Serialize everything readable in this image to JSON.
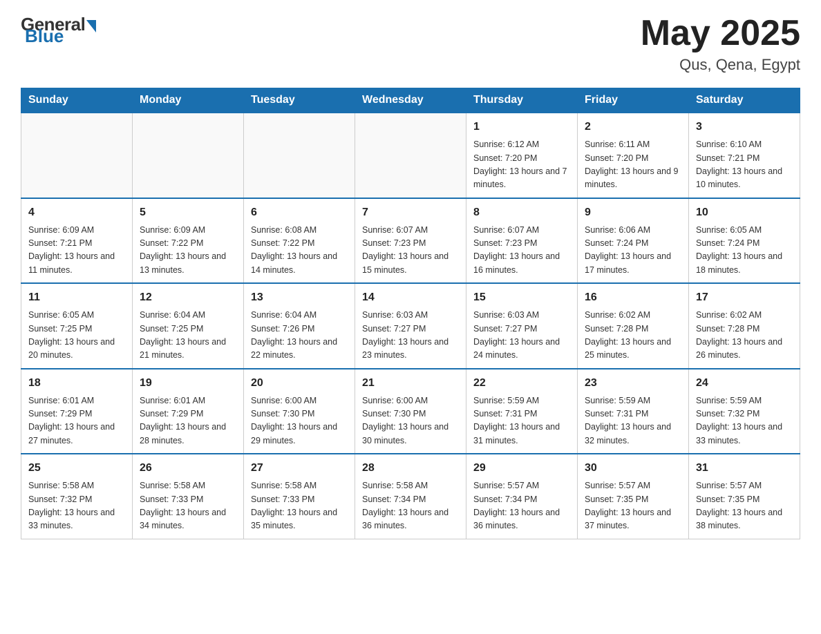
{
  "header": {
    "logo_general": "General",
    "logo_blue": "Blue",
    "month_title": "May 2025",
    "location": "Qus, Qena, Egypt"
  },
  "weekdays": [
    "Sunday",
    "Monday",
    "Tuesday",
    "Wednesday",
    "Thursday",
    "Friday",
    "Saturday"
  ],
  "weeks": [
    [
      {
        "day": "",
        "info": ""
      },
      {
        "day": "",
        "info": ""
      },
      {
        "day": "",
        "info": ""
      },
      {
        "day": "",
        "info": ""
      },
      {
        "day": "1",
        "info": "Sunrise: 6:12 AM\nSunset: 7:20 PM\nDaylight: 13 hours and 7 minutes."
      },
      {
        "day": "2",
        "info": "Sunrise: 6:11 AM\nSunset: 7:20 PM\nDaylight: 13 hours and 9 minutes."
      },
      {
        "day": "3",
        "info": "Sunrise: 6:10 AM\nSunset: 7:21 PM\nDaylight: 13 hours and 10 minutes."
      }
    ],
    [
      {
        "day": "4",
        "info": "Sunrise: 6:09 AM\nSunset: 7:21 PM\nDaylight: 13 hours and 11 minutes."
      },
      {
        "day": "5",
        "info": "Sunrise: 6:09 AM\nSunset: 7:22 PM\nDaylight: 13 hours and 13 minutes."
      },
      {
        "day": "6",
        "info": "Sunrise: 6:08 AM\nSunset: 7:22 PM\nDaylight: 13 hours and 14 minutes."
      },
      {
        "day": "7",
        "info": "Sunrise: 6:07 AM\nSunset: 7:23 PM\nDaylight: 13 hours and 15 minutes."
      },
      {
        "day": "8",
        "info": "Sunrise: 6:07 AM\nSunset: 7:23 PM\nDaylight: 13 hours and 16 minutes."
      },
      {
        "day": "9",
        "info": "Sunrise: 6:06 AM\nSunset: 7:24 PM\nDaylight: 13 hours and 17 minutes."
      },
      {
        "day": "10",
        "info": "Sunrise: 6:05 AM\nSunset: 7:24 PM\nDaylight: 13 hours and 18 minutes."
      }
    ],
    [
      {
        "day": "11",
        "info": "Sunrise: 6:05 AM\nSunset: 7:25 PM\nDaylight: 13 hours and 20 minutes."
      },
      {
        "day": "12",
        "info": "Sunrise: 6:04 AM\nSunset: 7:25 PM\nDaylight: 13 hours and 21 minutes."
      },
      {
        "day": "13",
        "info": "Sunrise: 6:04 AM\nSunset: 7:26 PM\nDaylight: 13 hours and 22 minutes."
      },
      {
        "day": "14",
        "info": "Sunrise: 6:03 AM\nSunset: 7:27 PM\nDaylight: 13 hours and 23 minutes."
      },
      {
        "day": "15",
        "info": "Sunrise: 6:03 AM\nSunset: 7:27 PM\nDaylight: 13 hours and 24 minutes."
      },
      {
        "day": "16",
        "info": "Sunrise: 6:02 AM\nSunset: 7:28 PM\nDaylight: 13 hours and 25 minutes."
      },
      {
        "day": "17",
        "info": "Sunrise: 6:02 AM\nSunset: 7:28 PM\nDaylight: 13 hours and 26 minutes."
      }
    ],
    [
      {
        "day": "18",
        "info": "Sunrise: 6:01 AM\nSunset: 7:29 PM\nDaylight: 13 hours and 27 minutes."
      },
      {
        "day": "19",
        "info": "Sunrise: 6:01 AM\nSunset: 7:29 PM\nDaylight: 13 hours and 28 minutes."
      },
      {
        "day": "20",
        "info": "Sunrise: 6:00 AM\nSunset: 7:30 PM\nDaylight: 13 hours and 29 minutes."
      },
      {
        "day": "21",
        "info": "Sunrise: 6:00 AM\nSunset: 7:30 PM\nDaylight: 13 hours and 30 minutes."
      },
      {
        "day": "22",
        "info": "Sunrise: 5:59 AM\nSunset: 7:31 PM\nDaylight: 13 hours and 31 minutes."
      },
      {
        "day": "23",
        "info": "Sunrise: 5:59 AM\nSunset: 7:31 PM\nDaylight: 13 hours and 32 minutes."
      },
      {
        "day": "24",
        "info": "Sunrise: 5:59 AM\nSunset: 7:32 PM\nDaylight: 13 hours and 33 minutes."
      }
    ],
    [
      {
        "day": "25",
        "info": "Sunrise: 5:58 AM\nSunset: 7:32 PM\nDaylight: 13 hours and 33 minutes."
      },
      {
        "day": "26",
        "info": "Sunrise: 5:58 AM\nSunset: 7:33 PM\nDaylight: 13 hours and 34 minutes."
      },
      {
        "day": "27",
        "info": "Sunrise: 5:58 AM\nSunset: 7:33 PM\nDaylight: 13 hours and 35 minutes."
      },
      {
        "day": "28",
        "info": "Sunrise: 5:58 AM\nSunset: 7:34 PM\nDaylight: 13 hours and 36 minutes."
      },
      {
        "day": "29",
        "info": "Sunrise: 5:57 AM\nSunset: 7:34 PM\nDaylight: 13 hours and 36 minutes."
      },
      {
        "day": "30",
        "info": "Sunrise: 5:57 AM\nSunset: 7:35 PM\nDaylight: 13 hours and 37 minutes."
      },
      {
        "day": "31",
        "info": "Sunrise: 5:57 AM\nSunset: 7:35 PM\nDaylight: 13 hours and 38 minutes."
      }
    ]
  ]
}
